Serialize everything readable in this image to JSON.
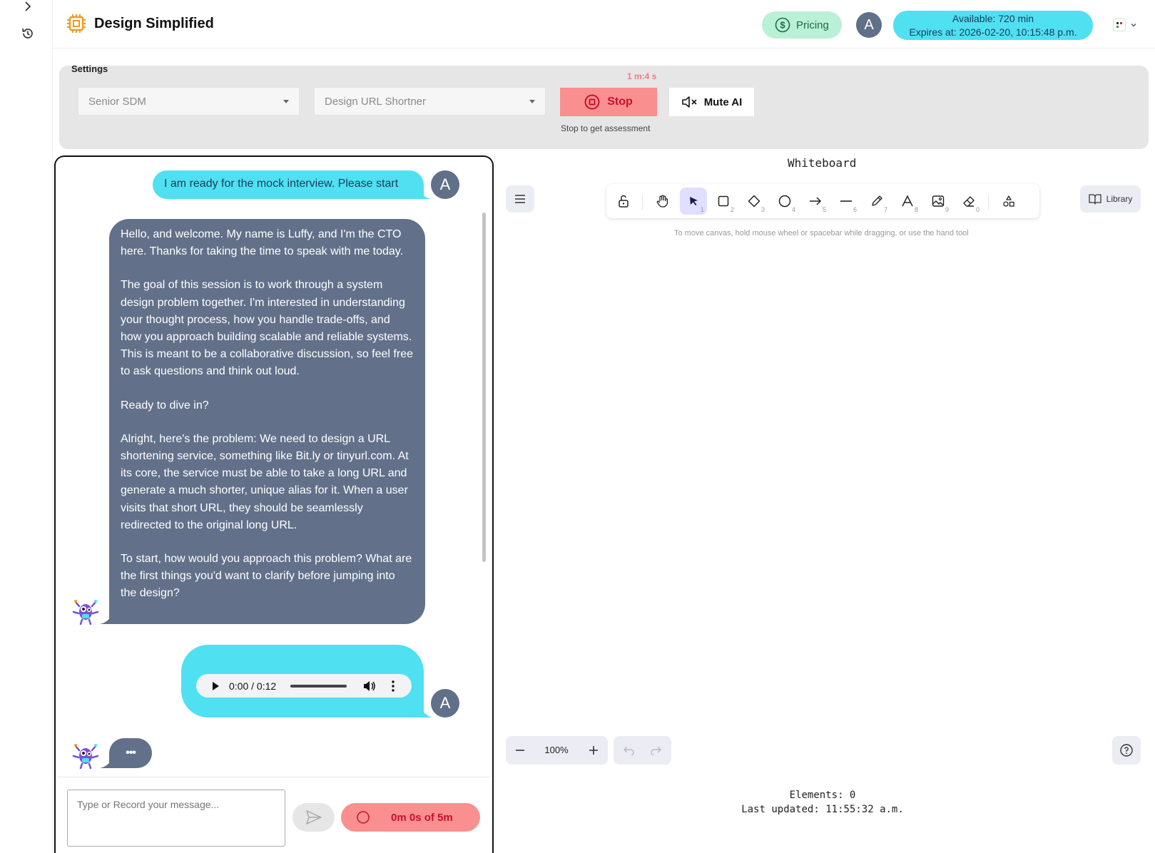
{
  "header": {
    "brand": "Design Simplified",
    "pricing_label": "Pricing",
    "avatar_letter": "A",
    "available": "Available: 720 min",
    "expires": "Expires at: 2026-02-20, 10:15:48 p.m."
  },
  "settings": {
    "title": "Settings",
    "role_select": "Senior SDM",
    "problem_select": "Design URL Shortner",
    "elapsed": "1 m:4 s",
    "stop_label": "Stop",
    "stop_caption": "Stop to get assessment",
    "mute_label": "Mute AI"
  },
  "chat": {
    "user_msg_1": "I am ready for the mock interview. Please start",
    "user_avatar": "A",
    "bot_paragraphs": [
      "Hello, and welcome. My name is Luffy, and I'm the CTO here. Thanks for taking the time to speak with me today.",
      "The goal of this session is to work through a system design problem together. I'm interested in understanding your thought process, how you handle trade-offs, and how you approach building scalable and reliable systems. This is meant to be a collaborative discussion, so feel free to ask questions and think out loud.",
      "Ready to dive in?",
      "Alright, here's the problem: We need to design a URL shortening service, something like Bit.ly or tinyurl.com. At its core, the service must be able to take a long URL and generate a much shorter, unique alias for it. When a user visits that short URL, they should be seamlessly redirected to the original long URL.",
      "To start, how would you approach this problem? What are the first things you'd want to clarify before jumping into the design?"
    ],
    "audio_time": "0:00 / 0:12",
    "typing_indicator": "•••",
    "input_placeholder": "Type or Record your message...",
    "record_label": "0m 0s of 5m"
  },
  "whiteboard": {
    "title": "Whiteboard",
    "library_label": "Library",
    "hint": "To move canvas, hold mouse wheel or spacebar while dragging, or use the hand tool",
    "zoom": "100%",
    "elements": "Elements: 0",
    "last_updated": "Last updated: 11:55:32 a.m.",
    "tool_keys": [
      "1",
      "2",
      "3",
      "4",
      "5",
      "6",
      "7",
      "8",
      "9",
      "0"
    ]
  },
  "colors": {
    "user_bubble": "#4fe0f2",
    "bot_bubble": "#627189",
    "stop_button": "#f98f8f",
    "pricing_bg": "#b9f0d6",
    "tool_active": "#e0dfff"
  }
}
